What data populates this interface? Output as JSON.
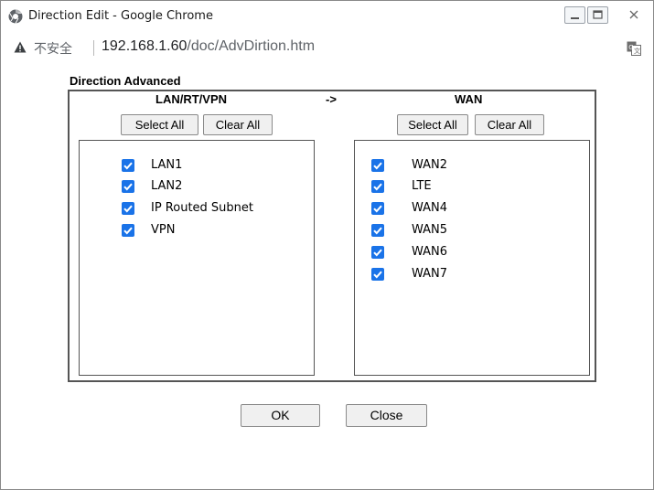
{
  "window": {
    "title": "Direction Edit - Google Chrome"
  },
  "address": {
    "insecure_label": "不安全",
    "host": "192.168.1.60",
    "path": "/doc/AdvDirtion.htm"
  },
  "dialog": {
    "section_title": "Direction Advanced",
    "arrow": "->",
    "left": {
      "heading": "LAN/RT/VPN",
      "select_all": "Select All",
      "clear_all": "Clear All",
      "items": [
        {
          "label": "LAN1",
          "checked": true
        },
        {
          "label": "LAN2",
          "checked": true
        },
        {
          "label": "IP Routed Subnet",
          "checked": true
        },
        {
          "label": "VPN",
          "checked": true
        }
      ]
    },
    "right": {
      "heading": "WAN",
      "select_all": "Select All",
      "clear_all": "Clear All",
      "items": [
        {
          "label": "WAN2",
          "checked": true
        },
        {
          "label": "LTE",
          "checked": true
        },
        {
          "label": "WAN4",
          "checked": true
        },
        {
          "label": "WAN5",
          "checked": true
        },
        {
          "label": "WAN6",
          "checked": true
        },
        {
          "label": "WAN7",
          "checked": true
        }
      ]
    },
    "ok_label": "OK",
    "close_label": "Close"
  },
  "colors": {
    "checkbox": "#1a73e8",
    "border": "#555555",
    "button_bg": "#f0f0f0"
  },
  "icons": [
    "chrome-icon",
    "warning-icon",
    "translate-icon",
    "minimize-icon",
    "maximize-icon",
    "close-icon",
    "checkbox-checked-icon"
  ]
}
